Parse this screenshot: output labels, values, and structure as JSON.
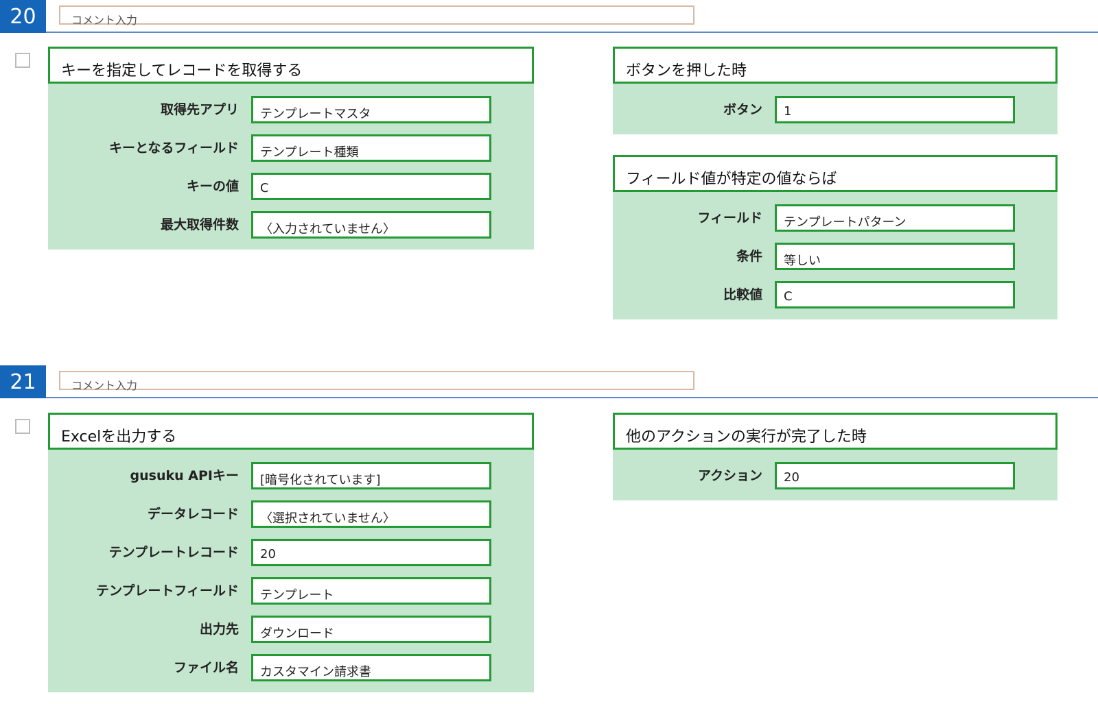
{
  "blocks": [
    {
      "number": "20",
      "comment_placeholder": "コメント入力",
      "action": {
        "title": "キーを指定してレコードを取得する",
        "fields": [
          {
            "label": "取得先アプリ",
            "value": "テンプレートマスタ"
          },
          {
            "label": "キーとなるフィールド",
            "value": "テンプレート種類"
          },
          {
            "label": "キーの値",
            "value": "C"
          },
          {
            "label": "最大取得件数",
            "value": "〈入力されていません〉"
          }
        ]
      },
      "conditions": [
        {
          "title": "ボタンを押した時",
          "fields": [
            {
              "label": "ボタン",
              "value": "1"
            }
          ]
        },
        {
          "title": "フィールド値が特定の値ならば",
          "fields": [
            {
              "label": "フィールド",
              "value": "テンプレートパターン"
            },
            {
              "label": "条件",
              "value": "等しい"
            },
            {
              "label": "比較値",
              "value": "C"
            }
          ]
        }
      ]
    },
    {
      "number": "21",
      "comment_placeholder": "コメント入力",
      "action": {
        "title": "Excelを出力する",
        "fields": [
          {
            "label": "gusuku APIキー",
            "value": "[暗号化されています]"
          },
          {
            "label": "データレコード",
            "value": "〈選択されていません〉"
          },
          {
            "label": "テンプレートレコード",
            "value": "20"
          },
          {
            "label": "テンプレートフィールド",
            "value": "テンプレート"
          },
          {
            "label": "出力先",
            "value": "ダウンロード"
          },
          {
            "label": "ファイル名",
            "value": "カスタマイン請求書"
          }
        ]
      },
      "conditions": [
        {
          "title": "他のアクションの実行が完了した時",
          "fields": [
            {
              "label": "アクション",
              "value": "20"
            }
          ]
        }
      ]
    }
  ],
  "colors": {
    "number_badge": "#1565b8",
    "panel_border": "#249a35",
    "panel_fill": "#c4e5ce"
  }
}
